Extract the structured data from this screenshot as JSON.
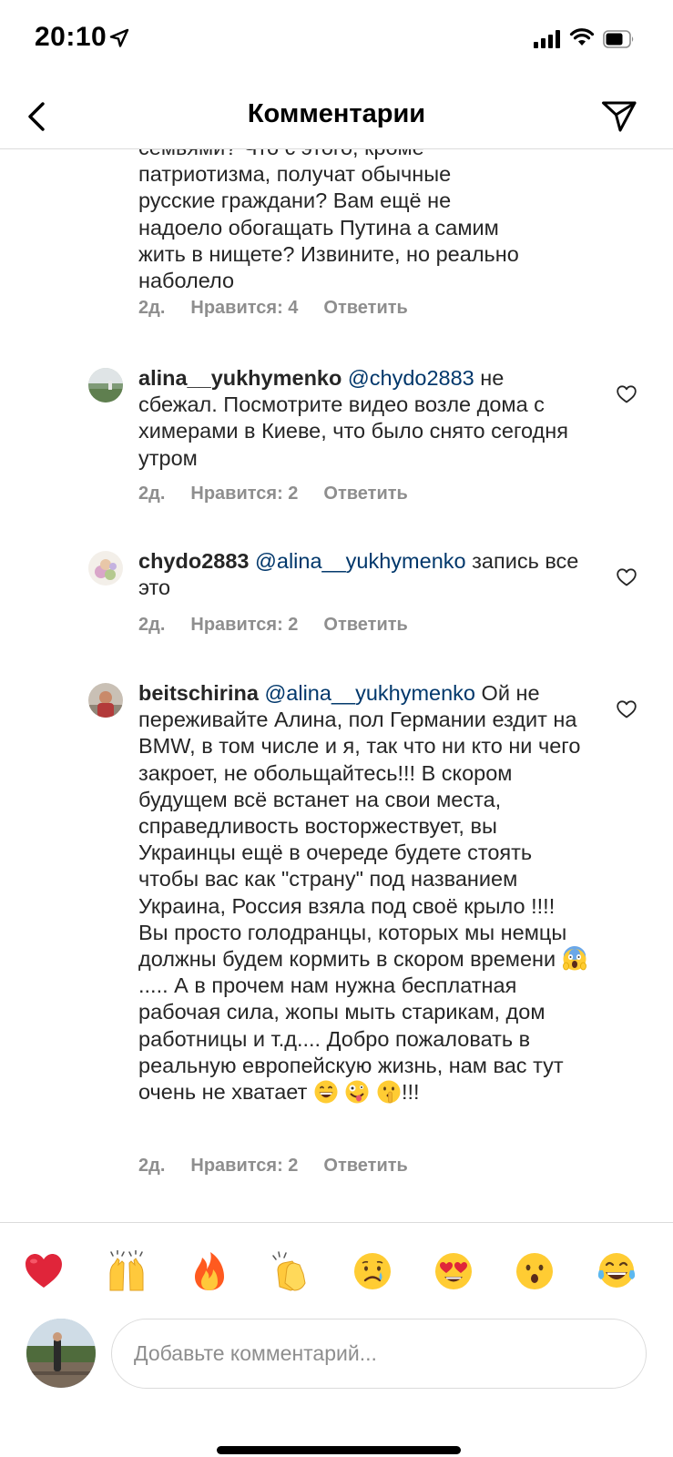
{
  "status_bar": {
    "time": "20:10",
    "icons": [
      "location-arrow-icon",
      "cellular-signal-icon",
      "wifi-icon",
      "battery-icon"
    ]
  },
  "header": {
    "title": "Комментарии",
    "back_icon": "chevron-left-icon",
    "share_icon": "paper-plane-icon"
  },
  "comments": [
    {
      "partial": true,
      "text_lines": [
        "семьями? Что с этого, кроме",
        "патриотизма, получат обычные",
        "русские граждани? Вам ещё не",
        "надоело обогащать Путина а самим",
        "жить в нищете? Извините, но реально",
        "наболело"
      ],
      "time": "2д.",
      "likes": "Нравится: 4",
      "reply": "Ответить"
    },
    {
      "username": "alina__yukhymenko",
      "mention": "@chydo2883",
      "text": " не сбежал. Посмотрите видео возле дома с химерами в Киеве, что было снято сегодня утром",
      "time": "2д.",
      "likes": "Нравится: 2",
      "reply": "Ответить"
    },
    {
      "username": "chydo2883",
      "mention": "@alina__yukhymenko",
      "text": " запись все это",
      "time": "2д.",
      "likes": "Нравится: 2",
      "reply": "Ответить"
    },
    {
      "username": "beitschirina",
      "mention": "@alina__yukhymenko",
      "text_a": " Ой не переживайте Алина, пол Германии ездит на BMW, в том числе и я, так что ни кто ни чего закроет, не обольщайтесь!!! В скором будущем  всё встанет на свои места, справедливость восторжествует, вы Украинцы ещё в очереде будете стоять чтобы вас как \"страну\" под названием Украина, Россия взяла под своё крыло !!!! Вы просто голодранцы, которых мы немцы должны будем кормить в скором времени ",
      "text_b": " ..... А в прочем нам нужна бесплатная рабочая сила, жопы мыть старикам, дом работницы и т.д.... Добро пожаловать в реальную европейскую жизнь, нам вас тут очень не хватает ",
      "text_c": "!!!",
      "inline_emojis": [
        "face-screaming-icon",
        "grinning-face-icon",
        "zany-face-icon",
        "shushing-face-icon"
      ],
      "time": "2д.",
      "likes": "Нравится: 2",
      "reply": "Ответить"
    }
  ],
  "quick_emojis": [
    "red-heart-icon",
    "raising-hands-icon",
    "fire-icon",
    "clapping-hands-icon",
    "crying-face-icon",
    "heart-eyes-icon",
    "surprised-face-icon",
    "tears-of-joy-icon"
  ],
  "input": {
    "placeholder": "Добавьте комментарий..."
  }
}
